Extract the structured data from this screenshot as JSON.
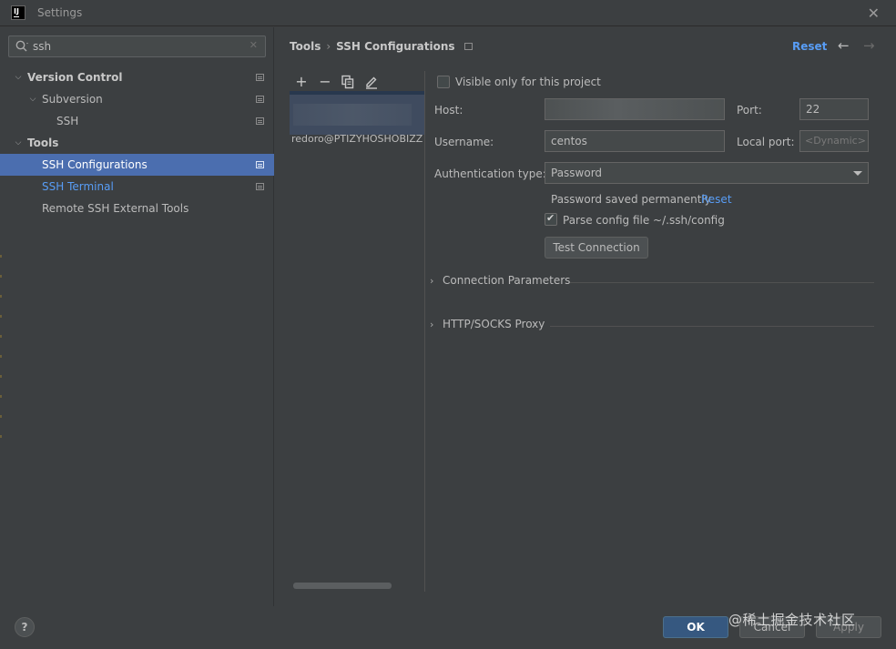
{
  "window": {
    "title": "Settings",
    "logo_text": "IJ"
  },
  "search": {
    "value": "ssh",
    "placeholder": ""
  },
  "tree": [
    {
      "label": "Version Control",
      "expanded": true
    },
    {
      "label": "Subversion",
      "expanded": true
    },
    {
      "label": "SSH"
    },
    {
      "label": "Tools",
      "expanded": true
    },
    {
      "label": "SSH Configurations",
      "selected": true
    },
    {
      "label": "SSH Terminal",
      "highlighted": true
    },
    {
      "label": "Remote SSH External Tools"
    }
  ],
  "breadcrumb": {
    "parent": "Tools",
    "current": "SSH Configurations",
    "separator": "›"
  },
  "header": {
    "reset_label": "Reset"
  },
  "config_list": {
    "second_item": "redoro@PTIZYHOSHOBIZZ"
  },
  "form": {
    "visible_only_label": "Visible only for this project",
    "host_label": "Host:",
    "host_value": "",
    "port_label": "Port:",
    "port_value": "22",
    "username_label": "Username:",
    "username_value": "centos",
    "local_port_label": "Local port:",
    "local_port_placeholder": "<Dynamic>",
    "auth_type_label": "Authentication type:",
    "auth_type_value": "Password",
    "password_saved_text": "Password saved permanently",
    "password_reset_label": "Reset",
    "parse_config_label": "Parse config file ~/.ssh/config",
    "test_connection_label": "Test Connection",
    "connection_params_label": "Connection Parameters",
    "proxy_label": "HTTP/SOCKS Proxy"
  },
  "footer": {
    "help_label": "?",
    "ok_label": "OK",
    "cancel_label": "Cancel",
    "apply_label": "Apply",
    "watermark": "@稀土掘金技术社区"
  },
  "colors": {
    "accent": "#4b6eaf",
    "link": "#589df6",
    "ok_button": "#365880",
    "background": "#3c3f41"
  }
}
